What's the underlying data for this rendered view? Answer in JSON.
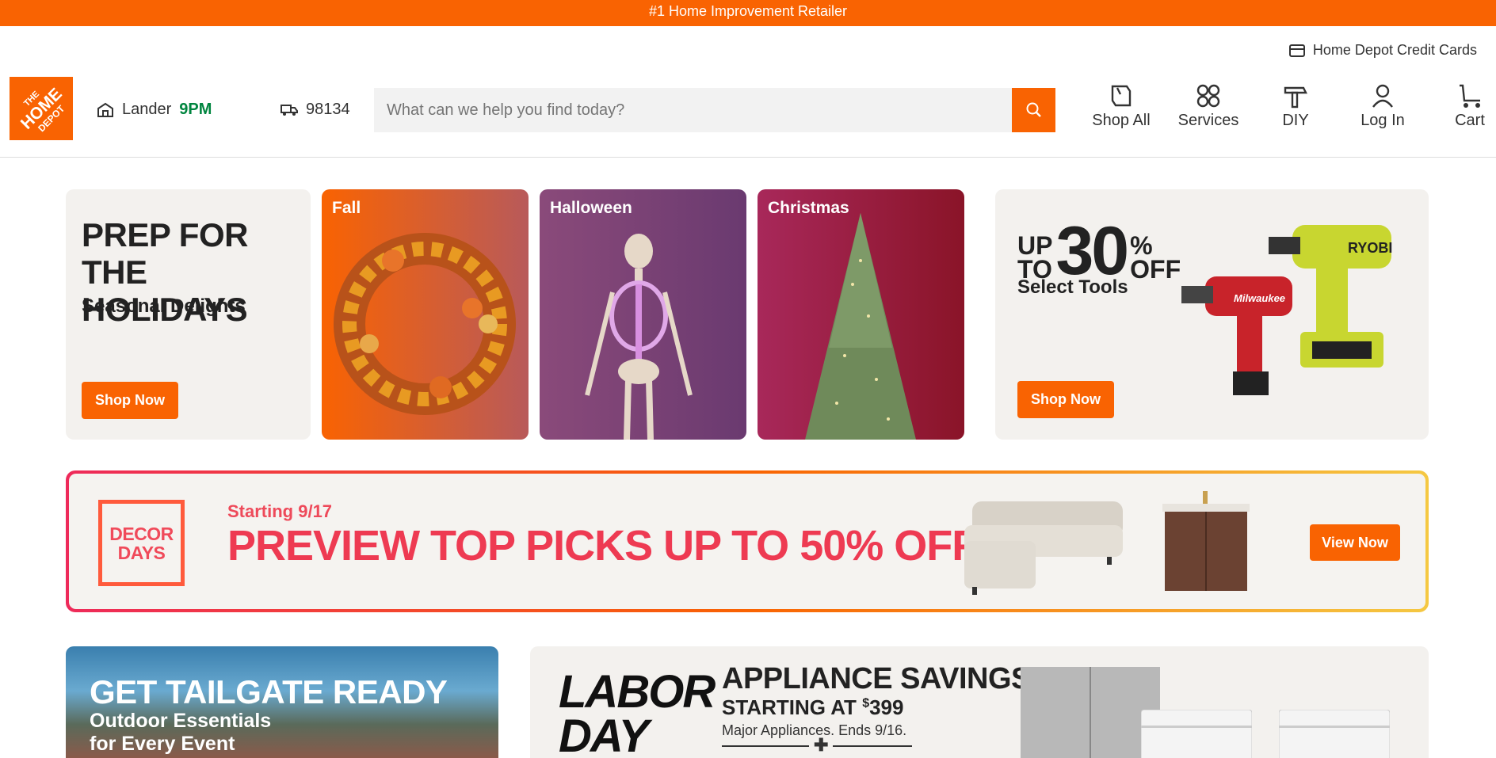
{
  "topbar": {
    "text": "#1 Home Improvement Retailer"
  },
  "header": {
    "credit_cards": "Home Depot Credit Cards",
    "logo_text": "THE HOME DEPOT",
    "store": {
      "name": "Lander",
      "time": "9PM"
    },
    "delivery_zip": "98134",
    "search": {
      "placeholder": "What can we help you find today?"
    },
    "nav": [
      {
        "label": "Shop All",
        "icon": "shop-all-icon"
      },
      {
        "label": "Services",
        "icon": "services-icon"
      },
      {
        "label": "DIY",
        "icon": "hammer-icon"
      },
      {
        "label": "Log In",
        "icon": "user-icon"
      },
      {
        "label": "Cart",
        "icon": "cart-icon"
      }
    ]
  },
  "promo": {
    "prep": {
      "title_line1": "PREP FOR",
      "title_line2": "THE HOLIDAYS",
      "subtitle": "Seasonal Delights",
      "button": "Shop Now"
    },
    "seasons": [
      {
        "label": "Fall"
      },
      {
        "label": "Halloween"
      },
      {
        "label": "Christmas"
      }
    ],
    "tools": {
      "up": "UP",
      "to": "TO",
      "percent": "30",
      "pct_sign": "%",
      "off": "OFF",
      "subtitle": "Select Tools",
      "button": "Shop Now",
      "brand1": "RYOBI",
      "brand2": "Milwaukee"
    }
  },
  "decor": {
    "badge_line1": "DECOR",
    "badge_line2": "DAYS",
    "starting": "Starting 9/17",
    "headline": "PREVIEW TOP PICKS UP TO 50% OFF",
    "button": "View Now"
  },
  "tailgate": {
    "title": "GET TAILGATE READY",
    "sub1": "Outdoor Essentials",
    "sub2": "for Every Event"
  },
  "appliance": {
    "labor1": "LABOR",
    "labor2": "DAY",
    "headline": "APPLIANCE SAVINGS",
    "starting": "STARTING AT",
    "price_sign": "$",
    "price": "399",
    "meta": "Major Appliances. Ends 9/16."
  },
  "colors": {
    "brand_orange": "#f96302",
    "open_green": "#00853f",
    "decor_red": "#ee3a52"
  }
}
